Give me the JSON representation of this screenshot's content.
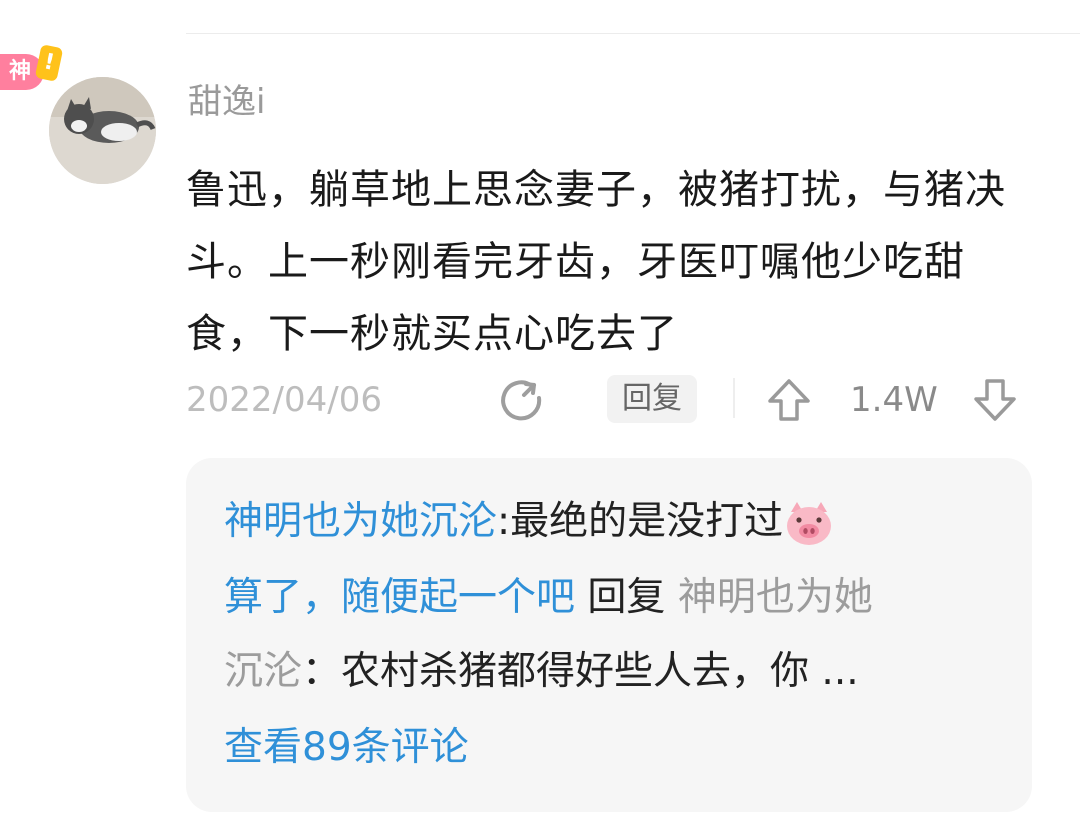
{
  "badge": {
    "label": "神",
    "mark": "!"
  },
  "comment": {
    "username": "甜逸i",
    "text": "鲁迅，躺草地上思念妻子，被猪打扰，与猪决斗。上一秒刚看完牙齿，牙医叮嘱他少吃甜食，下一秒就买点心吃去了",
    "date": "2022/04/06",
    "reply_label": "回复",
    "vote_count": "1.4W",
    "avatar_icon": "cat-photo",
    "share_icon": "share-icon",
    "upvote_icon": "upvote-arrow-icon",
    "downvote_icon": "downvote-arrow-icon"
  },
  "replies": {
    "first": {
      "author": "神明也为她沉沦",
      "separator": ":",
      "text": "最绝的是没打过",
      "emoji": "pig-face-emoji"
    },
    "second": {
      "author": "算了，随便起一个吧",
      "reply_word": "回复",
      "target_part1": "神明也为她",
      "target_part2": "沉沦",
      "separator": "：",
      "text": "农村杀猪都得好些人去，你 ..."
    },
    "view_more": "查看89条评论"
  },
  "colors": {
    "link_blue": "#2f90d8",
    "badge_pink": "#ff7f9e",
    "badge_yellow": "#ffc21a"
  }
}
